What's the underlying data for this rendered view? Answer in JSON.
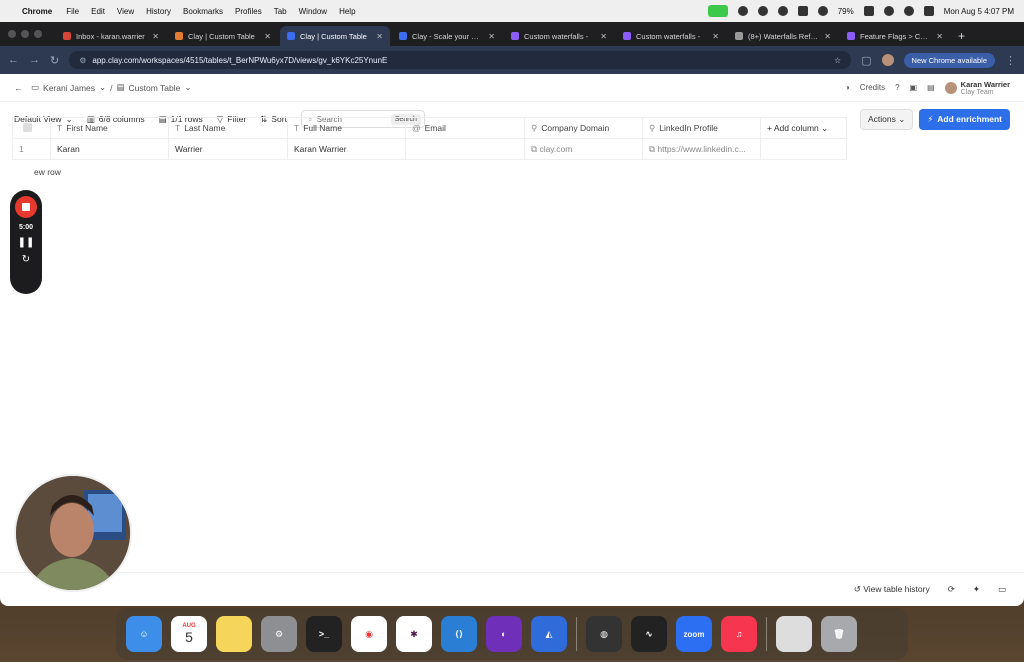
{
  "menubar": {
    "app": "Chrome",
    "menus": [
      "File",
      "Edit",
      "View",
      "History",
      "Bookmarks",
      "Profiles",
      "Tab",
      "Window",
      "Help"
    ],
    "battery": "79%",
    "clock": "Mon Aug 5  4:07 PM"
  },
  "tabs": [
    {
      "label": "Inbox - karan.warrier",
      "favicon": "gmail-icon"
    },
    {
      "label": "Clay | Custom Table",
      "favicon": "clay-icon"
    },
    {
      "label": "Clay | Custom Table",
      "favicon": "clay-icon",
      "active": true
    },
    {
      "label": "Clay - Scale your m…",
      "favicon": "clay-icon"
    },
    {
      "label": "Custom waterfalls -",
      "favicon": "figma-icon"
    },
    {
      "label": "Custom waterfalls -",
      "favicon": "figma-icon"
    },
    {
      "label": "(8+) Waterfalls Refa…",
      "favicon": "page-icon"
    },
    {
      "label": "Feature Flags > Cus…",
      "favicon": "page-icon"
    }
  ],
  "address": {
    "url": "app.clay.com/workspaces/4515/tables/t_BerNPWu6yx7D/views/gv_k6YKc25YnunE",
    "update_label": "New Chrome available"
  },
  "header": {
    "workspace": "Kerani James",
    "table": "Custom Table",
    "credits_label": "Credits",
    "user_name": "Karan Warrier",
    "user_team": "Clay Team"
  },
  "toolbar": {
    "view": "Default View",
    "columns": "6/8 columns",
    "rows": "1/1 rows",
    "filter": "Filter",
    "sort": "Sort",
    "search_placeholder": "Search",
    "search_button": "Search",
    "actions": "Actions",
    "add_enrichment": "Add enrichment"
  },
  "table": {
    "columns": [
      {
        "label": "First Name",
        "icon": "text-icon"
      },
      {
        "label": "Last Name",
        "icon": "text-icon"
      },
      {
        "label": "Full Name",
        "icon": "text-icon"
      },
      {
        "label": "Email",
        "icon": "at-icon"
      },
      {
        "label": "Company Domain",
        "icon": "link-icon"
      },
      {
        "label": "LinkedIn Profile",
        "icon": "link-icon"
      }
    ],
    "add_column": "Add column",
    "rows": [
      {
        "index": "1",
        "first": "Karan",
        "last": "Warrier",
        "full": "Karan Warrier",
        "email": "",
        "domain": "clay.com",
        "linkedin": "https://www.linkedin.c..."
      }
    ],
    "new_row": "ew row"
  },
  "recorder": {
    "timer": "5:00"
  },
  "footer": {
    "history": "View table history"
  },
  "dock": {
    "calendar_month": "AUG",
    "calendar_day": "5",
    "zoom_label": "zoom"
  }
}
